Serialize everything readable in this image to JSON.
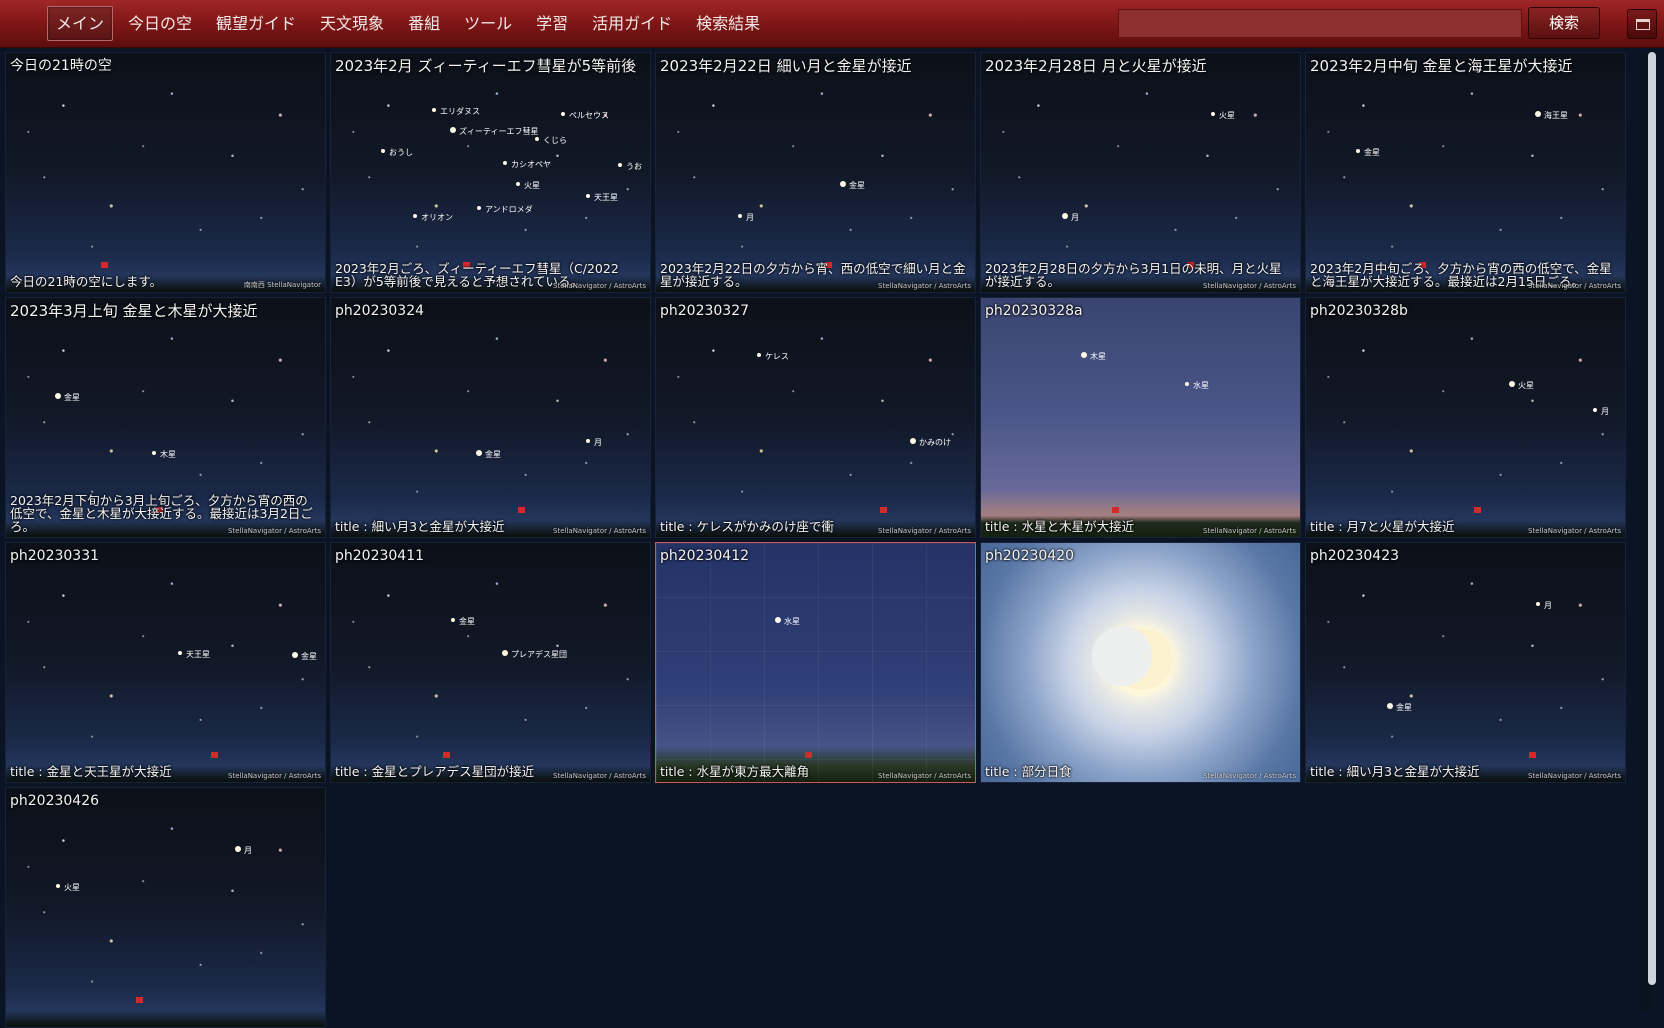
{
  "nav": {
    "items": [
      "メイン",
      "今日の空",
      "観望ガイド",
      "天文現象",
      "番組",
      "ツール",
      "学習",
      "活用ガイド",
      "検索結果"
    ],
    "active": "メイン"
  },
  "search": {
    "value": "",
    "button_label": "検索"
  },
  "tiles": [
    {
      "title": "今日の21時の空",
      "desc": "今日の21時の空にします。",
      "credit": "南南西   StellaNavigator",
      "style": "night",
      "labels": []
    },
    {
      "title": "2023年2月 ズィーティーエフ彗星が5等前後",
      "desc": "2023年2月ごろ、ズィーティーエフ彗星（C/2022 E3）が5等前後で見えると予想されている。",
      "credit": "StellaNavigator / AstroArts",
      "style": "night",
      "labels": [
        "ズィーティーエフ彗星",
        "火星",
        "オリオン",
        "ペルセウス",
        "おうし",
        "アンドロメダ",
        "天王星",
        "エリダヌス",
        "くじら",
        "うお",
        "カシオペヤ"
      ]
    },
    {
      "title": "2023年2月22日 細い月と金星が接近",
      "desc": "2023年2月22日の夕方から宵、西の低空で細い月と金星が接近する。",
      "credit": "StellaNavigator / AstroArts",
      "style": "night",
      "labels": [
        "金星",
        "月"
      ]
    },
    {
      "title": "2023年2月28日 月と火星が接近",
      "desc": "2023年2月28日の夕方から3月1日の未明、月と火星が接近する。",
      "credit": "StellaNavigator / AstroArts",
      "style": "night",
      "labels": [
        "月",
        "火星"
      ]
    },
    {
      "title": "2023年2月中旬 金星と海王星が大接近",
      "desc": "2023年2月中旬ごろ、夕方から宵の西の低空で、金星と海王星が大接近する。最接近は2月15日ごろ。",
      "credit": "StellaNavigator / AstroArts",
      "style": "night",
      "labels": [
        "海王星",
        "金星"
      ]
    },
    {
      "title": "2023年3月上旬 金星と木星が大接近",
      "desc": "2023年2月下旬から3月上旬ごろ、夕方から宵の西の低空で、金星と木星が大接近する。最接近は3月2日ごろ。",
      "credit": "StellaNavigator / AstroArts",
      "style": "night",
      "labels": [
        "金星",
        "木星"
      ]
    },
    {
      "title": "ph20230324",
      "desc": "title : 細い月3と金星が大接近",
      "credit": "StellaNavigator / AstroArts",
      "style": "night",
      "labels": [
        "金星",
        "月"
      ]
    },
    {
      "title": "ph20230327",
      "desc": "title : ケレスがかみのけ座で衝",
      "credit": "StellaNavigator / AstroArts",
      "style": "night",
      "labels": [
        "かみのけ",
        "ケレス"
      ]
    },
    {
      "title": "ph20230328a",
      "desc": "title : 水星と木星が大接近",
      "credit": "StellaNavigator / AstroArts",
      "style": "twilight",
      "labels": [
        "木星",
        "水星"
      ]
    },
    {
      "title": "ph20230328b",
      "desc": "title : 月7と火星が大接近",
      "credit": "StellaNavigator / AstroArts",
      "style": "night",
      "labels": [
        "火星",
        "月"
      ]
    },
    {
      "title": "ph20230331",
      "desc": "title : 金星と天王星が大接近",
      "credit": "StellaNavigator / AstroArts",
      "style": "night",
      "labels": [
        "金星",
        "天王星"
      ]
    },
    {
      "title": "ph20230411",
      "desc": "title : 金星とプレアデス星団が接近",
      "credit": "StellaNavigator / AstroArts",
      "style": "night",
      "labels": [
        "プレアデス星団",
        "金星"
      ]
    },
    {
      "title": "ph20230412",
      "desc": "title : 水星が東方最大離角",
      "credit": "StellaNavigator / AstroArts",
      "style": "twilight-grid",
      "labels": [
        "水星"
      ]
    },
    {
      "title": "ph20230420",
      "desc": "title : 部分日食",
      "credit": "StellaNavigator / AstroArts",
      "style": "eclipse",
      "labels": []
    },
    {
      "title": "ph20230423",
      "desc": "title : 細い月3と金星が大接近",
      "credit": "StellaNavigator / AstroArts",
      "style": "night",
      "labels": [
        "金星",
        "月"
      ]
    },
    {
      "title": "ph20230426",
      "desc": "",
      "credit": "",
      "style": "night",
      "labels": [
        "月",
        "火星"
      ]
    }
  ],
  "colors": {
    "topbar": "#8b1c1c",
    "background": "#0b1424",
    "selected_border": "#d25555"
  }
}
